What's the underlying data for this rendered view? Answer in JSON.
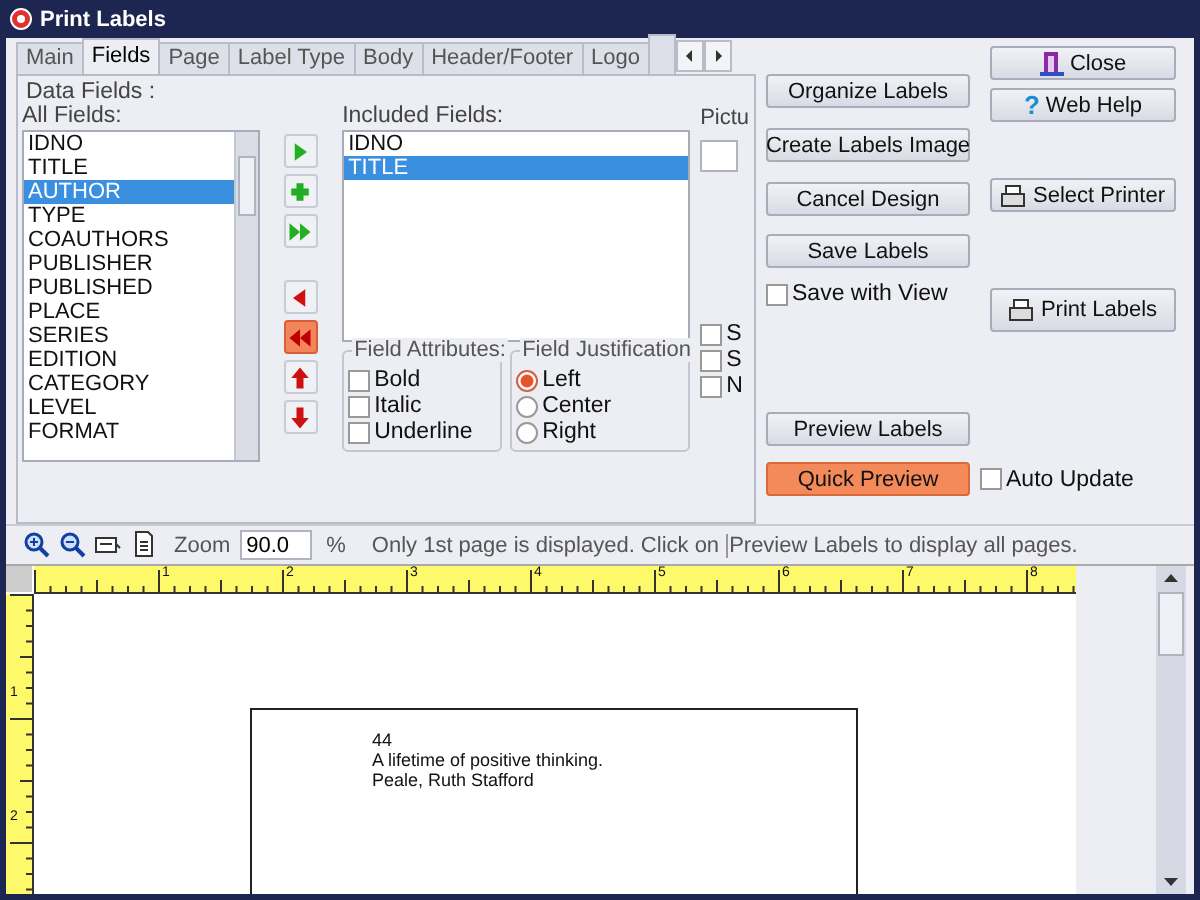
{
  "window": {
    "title": "Print Labels"
  },
  "tabs": [
    {
      "label": "Main",
      "selected": false
    },
    {
      "label": "Fields",
      "selected": true
    },
    {
      "label": "Page",
      "selected": false
    },
    {
      "label": "Label Type",
      "selected": false
    },
    {
      "label": "Body",
      "selected": false
    },
    {
      "label": "Header/Footer",
      "selected": false
    },
    {
      "label": "Logo",
      "selected": false
    }
  ],
  "data_fields": {
    "title": "Data Fields :",
    "all_label": "All Fields:",
    "all_fields": [
      {
        "label": "IDNO",
        "selected": false
      },
      {
        "label": "TITLE",
        "selected": false
      },
      {
        "label": "AUTHOR",
        "selected": true
      },
      {
        "label": "TYPE",
        "selected": false
      },
      {
        "label": "COAUTHORS",
        "selected": false
      },
      {
        "label": "PUBLISHER",
        "selected": false
      },
      {
        "label": "PUBLISHED",
        "selected": false
      },
      {
        "label": "PLACE",
        "selected": false
      },
      {
        "label": "SERIES",
        "selected": false
      },
      {
        "label": "EDITION",
        "selected": false
      },
      {
        "label": "CATEGORY",
        "selected": false
      },
      {
        "label": "LEVEL",
        "selected": false
      },
      {
        "label": "FORMAT",
        "selected": false
      }
    ],
    "move_buttons": [
      {
        "kind": "add",
        "highlighted": false
      },
      {
        "kind": "plus",
        "highlighted": false
      },
      {
        "kind": "add-all",
        "highlighted": false
      },
      {
        "kind": "remove",
        "highlighted": false
      },
      {
        "kind": "remove-all",
        "highlighted": true
      },
      {
        "kind": "up",
        "highlighted": false
      },
      {
        "kind": "down",
        "highlighted": false
      }
    ],
    "included_label": "Included Fields:",
    "included_fields": [
      {
        "label": "IDNO",
        "selected": false
      },
      {
        "label": "TITLE",
        "selected": true
      }
    ],
    "picture_label": "Pictu",
    "attributes": {
      "title": "Field Attributes:",
      "items": [
        {
          "label": "Bold",
          "checked": false
        },
        {
          "label": "Italic",
          "checked": false
        },
        {
          "label": "Underline",
          "checked": false
        }
      ]
    },
    "justification": {
      "title": "Field Justification",
      "items": [
        {
          "label": "Left",
          "selected": true
        },
        {
          "label": "Center",
          "selected": false
        },
        {
          "label": "Right",
          "selected": false
        }
      ]
    },
    "extra_options": [
      {
        "label": "S",
        "checked": false
      },
      {
        "label": "S",
        "checked": false
      },
      {
        "label": "N",
        "checked": false
      }
    ]
  },
  "actions": {
    "organize": "Organize Labels",
    "create_image": "Create Labels Image",
    "cancel": "Cancel Design",
    "save": "Save Labels",
    "save_with_view": {
      "label": "Save with View",
      "checked": false
    },
    "preview": "Preview Labels",
    "quick_preview": {
      "label": "Quick Preview",
      "highlighted": true
    },
    "auto_update": {
      "label": "Auto Update",
      "checked": false
    },
    "close": "Close",
    "web_help": "Web Help",
    "help_icon": "?",
    "select_printer": "Select Printer",
    "print": "Print Labels"
  },
  "toolbar": {
    "zoom_label": "Zoom",
    "zoom_value": "90.0",
    "percent": "%",
    "note_1": "Only 1st page is displayed. Click on",
    "note_2": "Preview Labels to display all pages."
  },
  "preview": {
    "h_ruler": [
      "1",
      "2",
      "3",
      "4",
      "5",
      "6",
      "7",
      "8"
    ],
    "v_ruler": [
      "1",
      "2"
    ],
    "label_lines": [
      "44",
      "A lifetime of positive thinking.",
      "Peale, Ruth Stafford"
    ]
  }
}
